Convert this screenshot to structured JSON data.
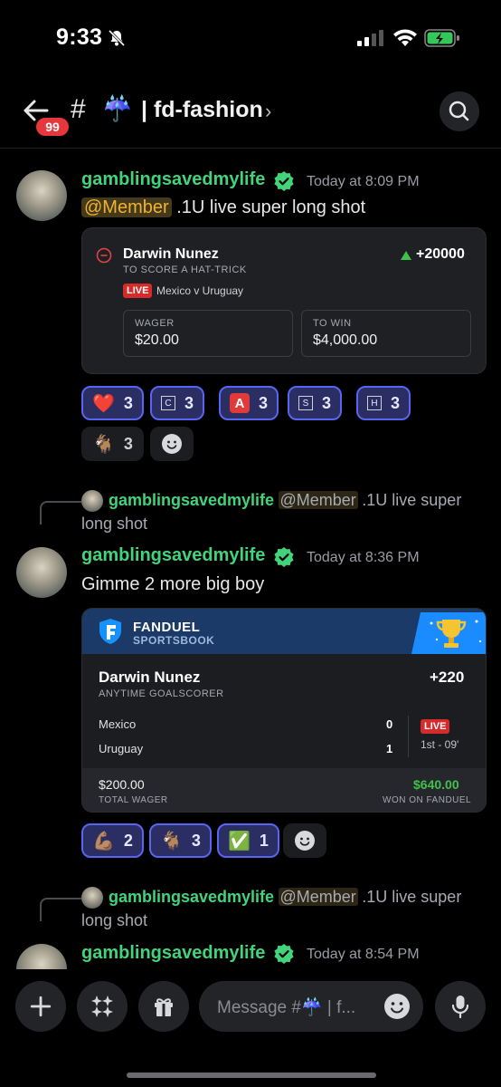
{
  "status_bar": {
    "time": "9:33"
  },
  "header": {
    "unread_badge": "99",
    "hash": "#",
    "umbrella": "☔",
    "channel_name": "| fd-fashion",
    "chevron": "›"
  },
  "messages": [
    {
      "username": "gamblingsavedmylife",
      "timestamp": "Today at 8:09 PM",
      "mention": "@Member",
      "text": ".1U live super long shot",
      "bet": {
        "player": "Darwin Nunez",
        "market": "TO SCORE A HAT-TRICK",
        "live": "LIVE",
        "match": "Mexico v Uruguay",
        "odds": "+20000",
        "wager_label": "WAGER",
        "wager": "$20.00",
        "towin_label": "TO WIN",
        "towin": "$4,000.00"
      },
      "reactions": [
        {
          "emoji": "❤️",
          "count": "3",
          "active": true
        },
        {
          "emoji": "C",
          "count": "3",
          "active": true
        },
        {
          "emoji": "A",
          "count": "3",
          "active": true
        },
        {
          "emoji": "S",
          "count": "3",
          "active": true
        },
        {
          "emoji": "H",
          "count": "3",
          "active": true
        },
        {
          "emoji": "🐐",
          "count": "3",
          "active": false
        }
      ]
    },
    {
      "reply": {
        "username": "gamblingsavedmylife",
        "mention": "@Member",
        "text_line1": ".1U live super",
        "text_line2": "long shot"
      },
      "username": "gamblingsavedmylife",
      "timestamp": "Today at 8:36 PM",
      "text": "Gimme 2 more big boy",
      "fanduel": {
        "brand": "FANDUEL",
        "sub": "SPORTSBOOK",
        "player": "Darwin Nunez",
        "market": "ANYTIME GOALSCORER",
        "odds": "+220",
        "team1": "Mexico",
        "score1": "0",
        "team2": "Uruguay",
        "score2": "1",
        "live": "LIVE",
        "clock": "1st - 09'",
        "wager": "$200.00",
        "wager_label": "TOTAL WAGER",
        "won": "$640.00",
        "won_label": "WON ON FANDUEL"
      },
      "reactions": [
        {
          "emoji": "💪🏽",
          "count": "2",
          "active": true
        },
        {
          "emoji": "🐐",
          "count": "3",
          "active": true
        },
        {
          "emoji": "✅",
          "count": "1",
          "active": true
        }
      ]
    },
    {
      "reply": {
        "username": "gamblingsavedmylife",
        "mention": "@Member",
        "text_line1": ".1U live super",
        "text_line2": "long shot"
      },
      "username": "gamblingsavedmylife",
      "timestamp": "Today at 8:54 PM"
    }
  ],
  "composer": {
    "placeholder": "Message #☔ | f..."
  },
  "colors": {
    "username_green": "#43d37a",
    "mention_gold": "#f0b232",
    "blurple": "#5865f2",
    "live_red": "#d52b2b",
    "win_green": "#3fc24a"
  }
}
